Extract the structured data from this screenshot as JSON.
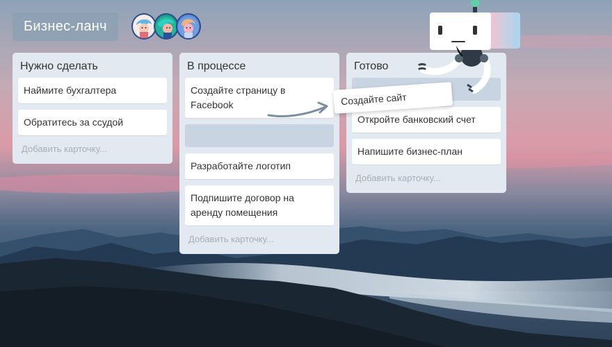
{
  "board": {
    "title": "Бизнес-ланч",
    "avatars": [
      "avatar-person-1-icon",
      "avatar-person-2-icon",
      "avatar-person-3-icon"
    ]
  },
  "lists": [
    {
      "title": "Нужно сделать",
      "cards": [
        "Наймите бухгалтера",
        "Обратитесь за ссудой"
      ],
      "add_card": "Добавить карточку..."
    },
    {
      "title": "В процессе",
      "cards": [
        "Создайте страницу в Facebook",
        "Разработайте логотип",
        "Подпишите договор на аренду помещения"
      ],
      "add_card": "Добавить карточку..."
    },
    {
      "title": "Готово",
      "cards": [
        "Откройте банковский счет",
        "Напишите бизнес-план"
      ],
      "add_card": "Добавить карточку..."
    }
  ],
  "dragged_card": {
    "label": "Создайте сайт"
  },
  "icons": {
    "mascot": "robot-mascot-icon",
    "arrow": "curved-arrow-icon"
  },
  "colors": {
    "list_bg": "#e3e9f0",
    "title_bg": "#8ca0b4",
    "placeholder": "#c8d4e1"
  }
}
